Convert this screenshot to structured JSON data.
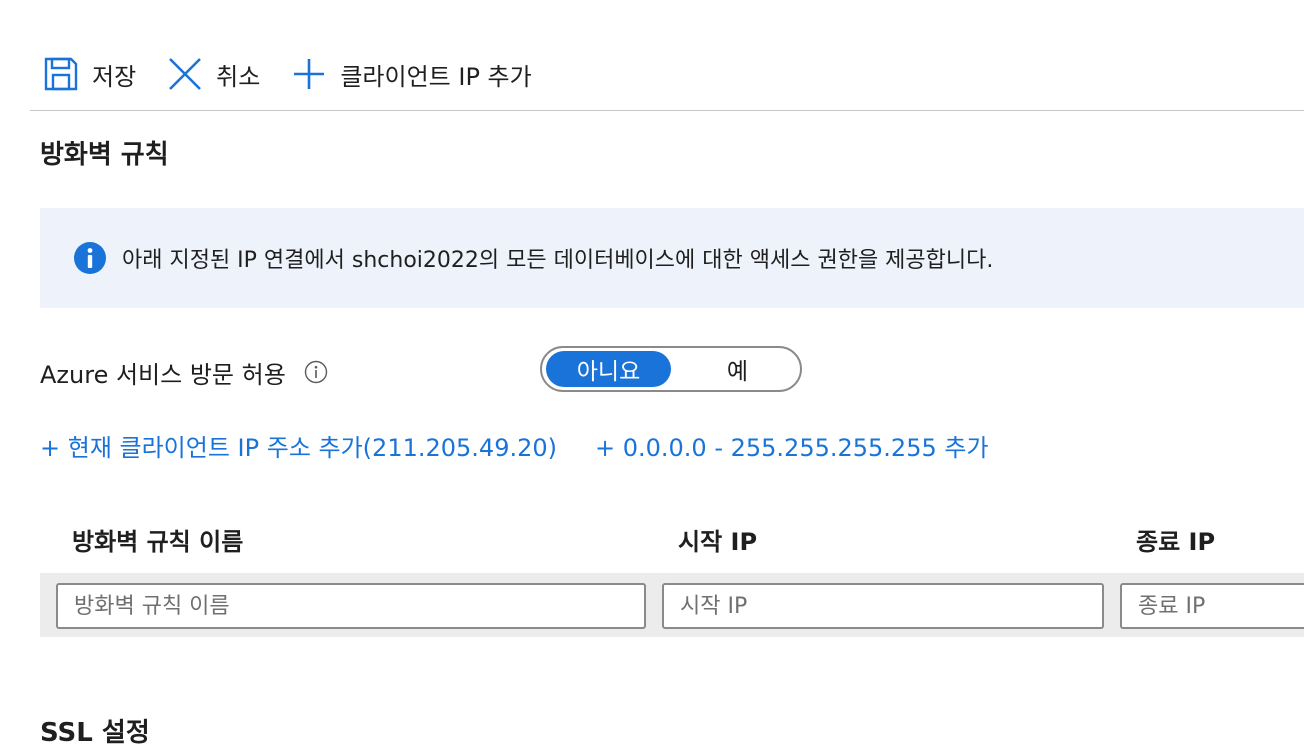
{
  "toolbar": {
    "save_label": "저장",
    "cancel_label": "취소",
    "add_client_ip_label": "클라이언트 IP 추가"
  },
  "firewall": {
    "title": "방화벽 규칙",
    "info_text": "아래 지정된 IP 연결에서 shchoi2022의 모든 데이터베이스에 대한 액세스 권한을 제공합니다.",
    "azure_services_label": "Azure 서비스 방문 허용",
    "toggle": {
      "no_label": "아니요",
      "yes_label": "예",
      "selected": "아니요"
    },
    "add_current_ip_link": "+ 현재 클라이언트 IP 주소 추가(211.205.49.20)",
    "add_all_range_link": "+ 0.0.0.0 - 255.255.255.255 추가",
    "table": {
      "headers": [
        "방화벽 규칙 이름",
        "시작 IP",
        "종료 IP"
      ],
      "placeholders": {
        "name": "방화벽 규칙 이름",
        "start_ip": "시작 IP",
        "end_ip": "종료 IP"
      }
    }
  },
  "ssl": {
    "title": "SSL 설정"
  },
  "colors": {
    "accent": "#1a73d9",
    "info_background": "#eef3fb",
    "row_background": "#ececec"
  }
}
